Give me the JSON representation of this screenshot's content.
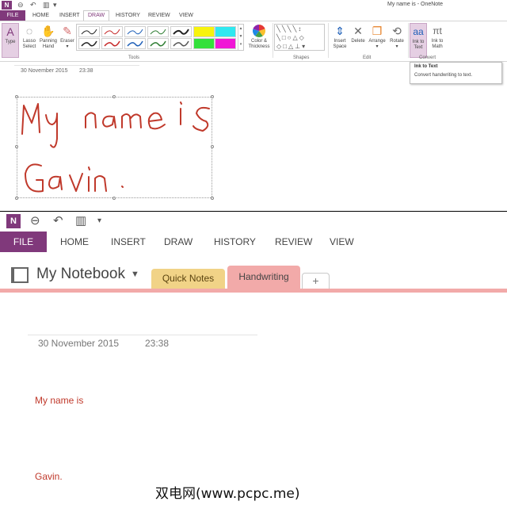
{
  "colors": {
    "accent": "#80397b",
    "ink": "#c0392b",
    "quick_notes_tab": "#f1d387",
    "handwriting_tab": "#f2aaa9"
  },
  "top": {
    "window_title": "My name is - OneNote",
    "tabs": [
      "FILE",
      "HOME",
      "INSERT",
      "DRAW",
      "HISTORY",
      "REVIEW",
      "VIEW"
    ],
    "active_tab": "DRAW",
    "tools": [
      {
        "line1": "Type",
        "line2": "",
        "icon": "type-cursor-icon"
      },
      {
        "line1": "Lasso",
        "line2": "Select",
        "icon": "lasso-icon"
      },
      {
        "line1": "Panning",
        "line2": "Hand",
        "icon": "hand-icon"
      },
      {
        "line1": "Eraser",
        "line2": "▾",
        "icon": "eraser-icon"
      }
    ],
    "color_thickness": {
      "line1": "Color &",
      "line2": "Thickness"
    },
    "edit_tools": [
      {
        "line1": "Insert",
        "line2": "Space",
        "icon": "insert-space-icon"
      },
      {
        "line1": "Delete",
        "line2": "",
        "icon": "delete-x-icon"
      },
      {
        "line1": "Arrange",
        "line2": "▾",
        "icon": "arrange-icon"
      },
      {
        "line1": "Rotate",
        "line2": "▾",
        "icon": "rotate-icon"
      }
    ],
    "convert_tools": [
      {
        "line1": "Ink to",
        "line2": "Text",
        "icon": "ink-to-text-icon"
      },
      {
        "line1": "Ink to",
        "line2": "Math",
        "icon": "ink-to-math-icon"
      }
    ],
    "group_labels": {
      "tools": "Tools",
      "shapes": "Shapes",
      "edit": "Edit",
      "convert": "Convert"
    },
    "tooltip": {
      "title": "Ink to Text",
      "description": "Convert handwriting to text."
    },
    "date": "30 November 2015",
    "time": "23:38",
    "handwriting_content": "My name is Gavin"
  },
  "bottom": {
    "tabs": [
      "FILE",
      "HOME",
      "INSERT",
      "DRAW",
      "HISTORY",
      "REVIEW",
      "VIEW"
    ],
    "notebook_name": "My Notebook",
    "sections": [
      "Quick Notes",
      "Handwriting"
    ],
    "add_section": "+",
    "date": "30 November 2015",
    "time": "23:38",
    "lines": [
      "My name is",
      "Gavin."
    ]
  },
  "watermark": "双电网(www.pcpc.me)"
}
